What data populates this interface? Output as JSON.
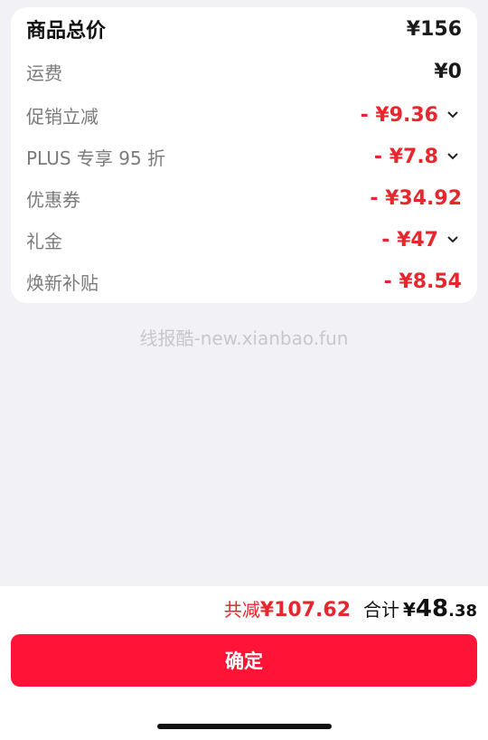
{
  "price_card": {
    "rows": [
      {
        "label": "商品总价",
        "value": "¥156",
        "style": "total",
        "chevron": false
      },
      {
        "label": "运费",
        "value": "¥0",
        "style": "normal",
        "chevron": false
      },
      {
        "label": "促销立减",
        "value": "- ¥9.36",
        "style": "discount",
        "chevron": true
      },
      {
        "label": "PLUS 专享 95 折",
        "value": "- ¥7.8",
        "style": "discount",
        "chevron": true
      },
      {
        "label": "优惠券",
        "value": "- ¥34.92",
        "style": "discount",
        "chevron": false
      },
      {
        "label": "礼金",
        "value": "- ¥47",
        "style": "discount",
        "chevron": true
      },
      {
        "label": "焕新补贴",
        "value": "- ¥8.54",
        "style": "discount",
        "chevron": false
      }
    ]
  },
  "watermark": "线报酷-new.xianbao.fun",
  "footer": {
    "saved_label": "共减",
    "saved_value": "¥107.62",
    "total_label": "合计",
    "total_currency": "¥",
    "total_integer": "48",
    "total_decimal": ".38",
    "confirm_label": "确定"
  },
  "colors": {
    "accent_red": "#e8262e",
    "button_red": "#ff1437",
    "background": "#f2f2f6"
  }
}
